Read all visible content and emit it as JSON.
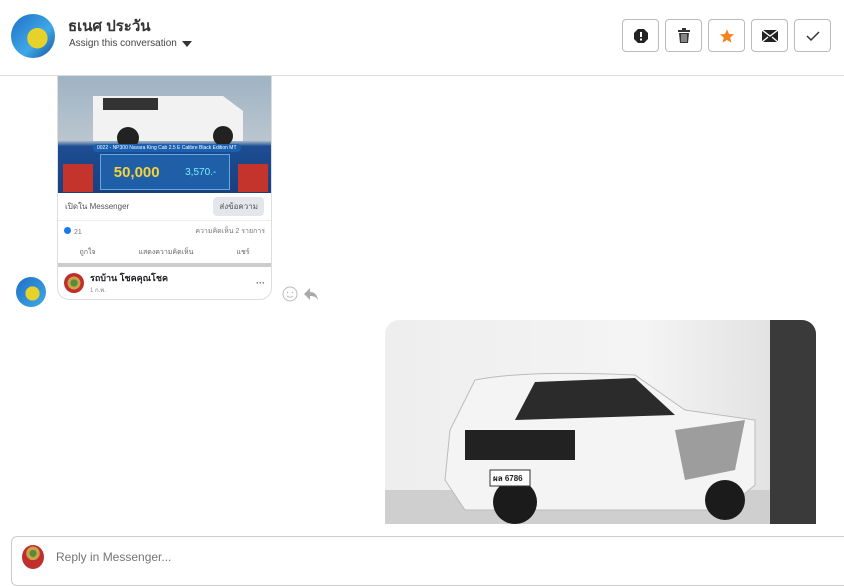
{
  "header": {
    "name": "ธเนศ ประวัน",
    "assign_label": "Assign this conversation",
    "actions": [
      {
        "icon": "alert-icon"
      },
      {
        "icon": "trash-icon"
      },
      {
        "icon": "star-icon",
        "color": "#f58220"
      },
      {
        "icon": "envelope-icon"
      },
      {
        "icon": "check-icon"
      }
    ]
  },
  "card": {
    "banner_title": "0022 - NP300 Navara King Cab 2.5 E Calibre Black Edition MT",
    "discount": "50,000",
    "installment": "3,570.-",
    "open_messenger": "เปิดใน Messenger",
    "send_message": "ส่งข้อความ",
    "likes": "21",
    "comments": "ความคิดเห็น 2 รายการ",
    "like": "ถูกใจ",
    "comment": "แสดงความคิดเห็น",
    "share": "แชร์",
    "page_name": "รถบ้าน โชคคุณโชค",
    "post_time": "1 ก.พ."
  },
  "reply": {
    "placeholder": "Reply in Messenger..."
  },
  "photo": {
    "plate": "ผล 6786"
  }
}
